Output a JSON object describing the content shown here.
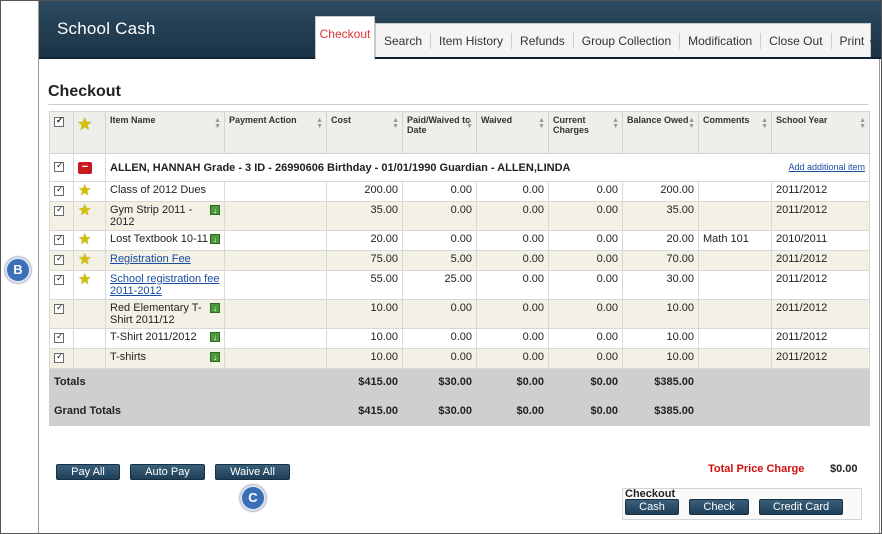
{
  "app": {
    "title": "School Cash"
  },
  "nav": {
    "active_tab": "Checkout",
    "items": [
      "Search",
      "Item History",
      "Refunds",
      "Group Collection",
      "Modification",
      "Close Out",
      "Print"
    ]
  },
  "page": {
    "title": "Checkout"
  },
  "table": {
    "columns": [
      "Item Name",
      "Payment Action",
      "Cost",
      "Paid/Waived to Date",
      "Waived",
      "Current Charges",
      "Balance Owed",
      "Comments",
      "School Year"
    ],
    "student": {
      "label": "ALLEN, HANNAH Grade - 3 ID - 26990606 Birthday - 01/01/1990 Guardian - ALLEN,LINDA",
      "add_link": "Add additional item"
    },
    "rows": [
      {
        "name": "Class of 2012 Dues",
        "link": false,
        "star": true,
        "dl": false,
        "cost": "200.00",
        "paid": "0.00",
        "waived": "0.00",
        "current": "0.00",
        "balance": "200.00",
        "comments": "",
        "year": "2011/2012"
      },
      {
        "name": "Gym Strip 2011 - 2012",
        "link": false,
        "star": true,
        "dl": true,
        "cost": "35.00",
        "paid": "0.00",
        "waived": "0.00",
        "current": "0.00",
        "balance": "35.00",
        "comments": "",
        "year": "2011/2012"
      },
      {
        "name": "Lost Textbook 10-11",
        "link": false,
        "star": true,
        "dl": true,
        "cost": "20.00",
        "paid": "0.00",
        "waived": "0.00",
        "current": "0.00",
        "balance": "20.00",
        "comments": "Math 101",
        "year": "2010/2011"
      },
      {
        "name": "Registration Fee",
        "link": true,
        "star": true,
        "dl": false,
        "cost": "75.00",
        "paid": "5.00",
        "waived": "0.00",
        "current": "0.00",
        "balance": "70.00",
        "comments": "",
        "year": "2011/2012"
      },
      {
        "name": "School registration fee 2011-2012",
        "link": true,
        "star": true,
        "dl": false,
        "cost": "55.00",
        "paid": "25.00",
        "waived": "0.00",
        "current": "0.00",
        "balance": "30.00",
        "comments": "",
        "year": "2011/2012"
      },
      {
        "name": "Red Elementary T-Shirt 2011/12",
        "link": false,
        "star": false,
        "dl": true,
        "cost": "10.00",
        "paid": "0.00",
        "waived": "0.00",
        "current": "0.00",
        "balance": "10.00",
        "comments": "",
        "year": "2011/2012"
      },
      {
        "name": "T-Shirt 2011/2012",
        "link": false,
        "star": false,
        "dl": true,
        "cost": "10.00",
        "paid": "0.00",
        "waived": "0.00",
        "current": "0.00",
        "balance": "10.00",
        "comments": "",
        "year": "2011/2012"
      },
      {
        "name": "T-shirts",
        "link": false,
        "star": false,
        "dl": true,
        "cost": "10.00",
        "paid": "0.00",
        "waived": "0.00",
        "current": "0.00",
        "balance": "10.00",
        "comments": "",
        "year": "2011/2012"
      }
    ],
    "totals": {
      "label": "Totals",
      "cost": "$415.00",
      "paid": "$30.00",
      "waived": "$0.00",
      "current": "$0.00",
      "balance": "$385.00"
    },
    "grand_totals": {
      "label": "Grand Totals",
      "cost": "$415.00",
      "paid": "$30.00",
      "waived": "$0.00",
      "current": "$0.00",
      "balance": "$385.00"
    }
  },
  "actions": {
    "pay_all": "Pay All",
    "auto_pay": "Auto Pay",
    "waive_all": "Waive All"
  },
  "summary": {
    "total_price_label": "Total Price Charge",
    "total_price_value": "$0.00"
  },
  "checkout_box": {
    "title": "Checkout",
    "cash": "Cash",
    "check": "Check",
    "credit_card": "Credit Card"
  },
  "callouts": {
    "b": "B",
    "c": "C"
  },
  "colors": {
    "header": "#1b3346",
    "accent_red": "#d01010",
    "row_alt": "#f3f1e6",
    "button": "#1f3f58"
  }
}
